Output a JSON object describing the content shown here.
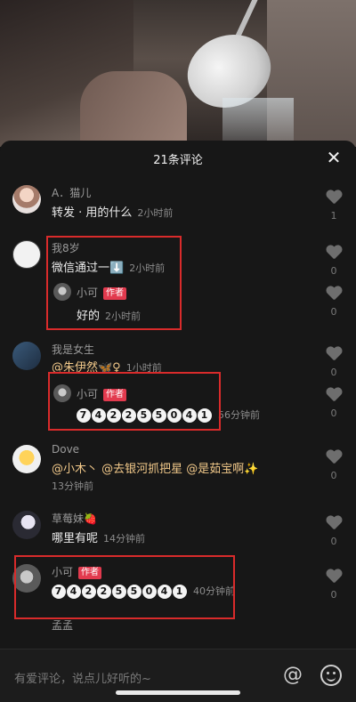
{
  "sheet": {
    "title": "21条评论"
  },
  "comments": [
    {
      "user": "A．猫儿",
      "text": "转发 · 用的什么",
      "time": "2小时前",
      "likes": "1"
    },
    {
      "user": "我8岁",
      "text": "微信通过一⬇️",
      "time": "2小时前",
      "likes": "0",
      "reply": {
        "user": "小可",
        "badge": "作者",
        "text": "好的",
        "time": "2小时前",
        "likes": "0"
      }
    },
    {
      "user": "我是女生",
      "text": "@朱伊然🦋♀",
      "time": "1小时前",
      "likes": "0",
      "reply": {
        "user": "小可",
        "badge": "作者",
        "digits": "742255041",
        "time": "56分钟前",
        "likes": "0"
      }
    },
    {
      "user": "Dove",
      "text": "@小木丶 @去银河抓把星 @是茹宝啊✨",
      "time": "13分钟前",
      "likes": "0"
    },
    {
      "user": "草莓妹🍓",
      "text": "哪里有呢",
      "time": "14分钟前",
      "likes": "0"
    },
    {
      "user": "小可",
      "badge": "作者",
      "digits": "742255041",
      "time": "40分钟前",
      "likes": "0"
    },
    {
      "user": "孟孟"
    }
  ],
  "input": {
    "placeholder": "有爱评论，说点儿好听的~"
  }
}
